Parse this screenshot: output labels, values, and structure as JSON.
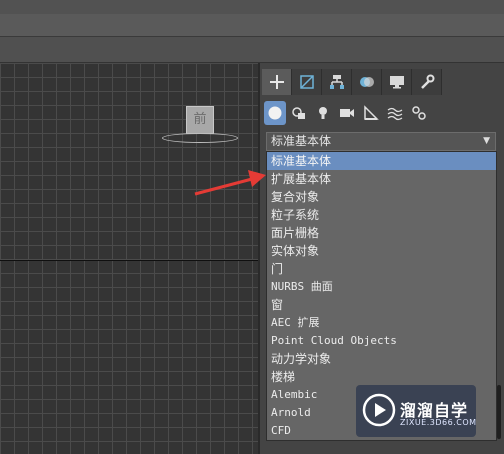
{
  "viewport": {
    "viewcube_label": "前"
  },
  "command_panel": {
    "tabs": [
      {
        "icon": "plus-create-icon"
      },
      {
        "icon": "modify-icon"
      },
      {
        "icon": "hierarchy-icon"
      },
      {
        "icon": "motion-icon"
      },
      {
        "icon": "display-icon"
      },
      {
        "icon": "utilities-wrench-icon"
      }
    ],
    "subcategories": [
      {
        "icon": "geometry-sphere-icon"
      },
      {
        "icon": "shapes-icon"
      },
      {
        "icon": "lights-icon"
      },
      {
        "icon": "cameras-icon"
      },
      {
        "icon": "helpers-icon"
      },
      {
        "icon": "space-warps-icon"
      },
      {
        "icon": "systems-icon"
      }
    ],
    "dropdown": {
      "selected": "标准基本体",
      "options": [
        "标准基本体",
        "扩展基本体",
        "复合对象",
        "粒子系统",
        "面片栅格",
        "实体对象",
        "门",
        "NURBS 曲面",
        "窗",
        "AEC 扩展",
        "Point Cloud Objects",
        "动力学对象",
        "楼梯",
        "Alembic",
        "Arnold",
        "CFD"
      ]
    }
  },
  "watermark": {
    "title": "溜溜自学",
    "url": "ZIXUE.3D66.COM"
  },
  "colors": {
    "highlight": "#6a8ec0",
    "annotation_arrow": "#e43b35"
  }
}
